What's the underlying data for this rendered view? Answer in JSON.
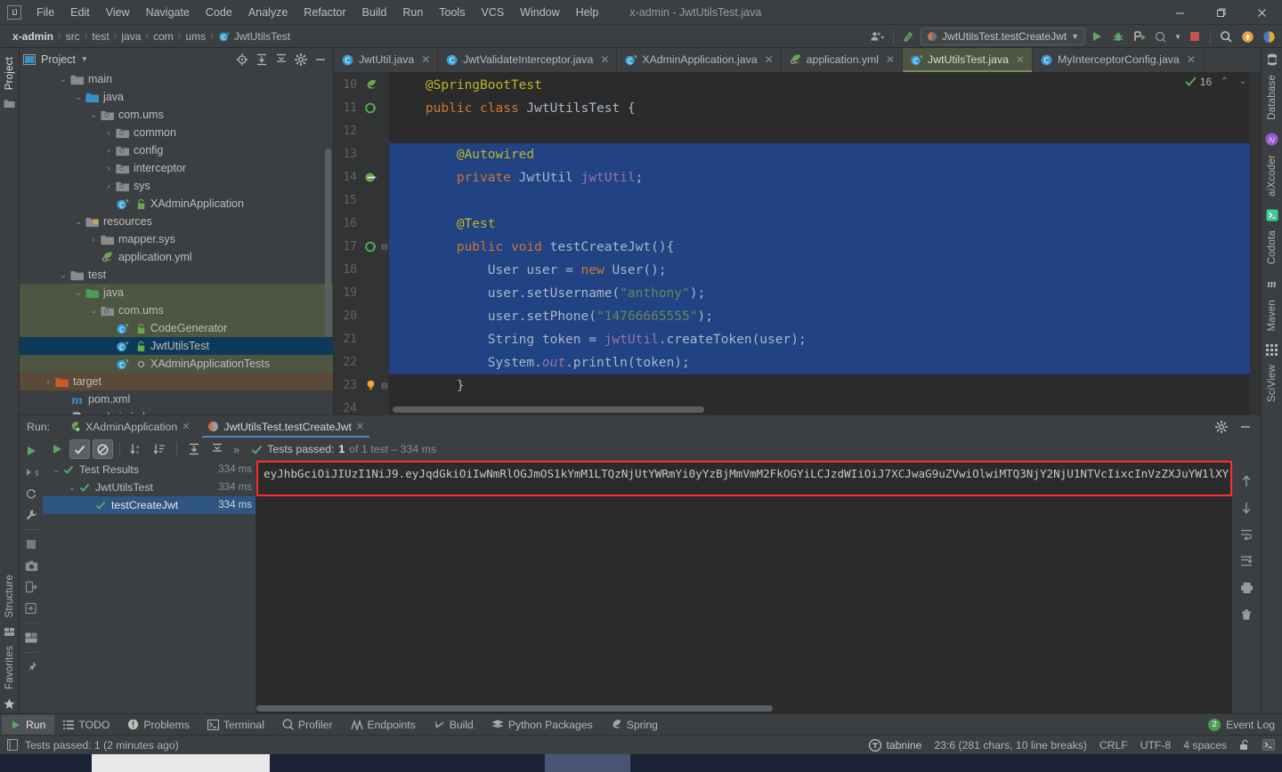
{
  "window": {
    "title": "x-admin - JwtUtilsTest.java",
    "logo": "IJ",
    "minimize": "—",
    "maximize": "❐",
    "close": "✕"
  },
  "menubar": {
    "items": [
      "File",
      "Edit",
      "View",
      "Navigate",
      "Code",
      "Analyze",
      "Refactor",
      "Build",
      "Run",
      "Tools",
      "VCS",
      "Window",
      "Help"
    ]
  },
  "breadcrumb": {
    "items": [
      "x-admin",
      "src",
      "test",
      "java",
      "com",
      "ums",
      "JwtUtilsTest"
    ],
    "separator": "›"
  },
  "toolbar": {
    "run_config": "JwtUtilsTest.testCreateJwt",
    "icons": [
      "user-dropdown-icon",
      "update-project-icon",
      "run-icon",
      "debug-icon",
      "run-with-coverage-icon",
      "profiler-icon",
      "stop-icon",
      "search-everywhere-icon",
      "notifications-icon",
      "ai-assistant-icon"
    ]
  },
  "left_strip": {
    "top": [
      "Project"
    ],
    "bottom": [
      "Structure",
      "Favorites"
    ]
  },
  "right_strip": {
    "items": [
      "Database",
      "aiXcoder",
      "Codota",
      "Maven",
      "SciView"
    ]
  },
  "project_panel": {
    "title": "Project",
    "header_icons": [
      "locate-icon",
      "expand-all-icon",
      "collapse-all-icon",
      "settings-gear-icon",
      "hide-icon"
    ],
    "tree": [
      {
        "label": "main",
        "indent": 2,
        "arrow": "⌄",
        "icon": "folder-gray",
        "state": "none"
      },
      {
        "label": "java",
        "indent": 3,
        "arrow": "⌄",
        "icon": "folder-blue",
        "state": "none"
      },
      {
        "label": "com.ums",
        "indent": 4,
        "arrow": "⌄",
        "icon": "package-icon",
        "state": "none"
      },
      {
        "label": "common",
        "indent": 5,
        "arrow": "›",
        "icon": "package-icon",
        "state": "none"
      },
      {
        "label": "config",
        "indent": 5,
        "arrow": "›",
        "icon": "package-icon",
        "state": "none"
      },
      {
        "label": "interceptor",
        "indent": 5,
        "arrow": "›",
        "icon": "package-icon",
        "state": "none"
      },
      {
        "label": "sys",
        "indent": 5,
        "arrow": "›",
        "icon": "package-icon",
        "state": "none"
      },
      {
        "label": "XAdminApplication",
        "indent": 5,
        "arrow": "",
        "icon": "spring-class",
        "state": "none"
      },
      {
        "label": "resources",
        "indent": 3,
        "arrow": "⌄",
        "icon": "folder-res",
        "state": "none"
      },
      {
        "label": "mapper.sys",
        "indent": 4,
        "arrow": "›",
        "icon": "folder-gray",
        "state": "none"
      },
      {
        "label": "application.yml",
        "indent": 4,
        "arrow": "",
        "icon": "spring-yml",
        "state": "none"
      },
      {
        "label": "test",
        "indent": 2,
        "arrow": "⌄",
        "icon": "folder-gray",
        "state": "none"
      },
      {
        "label": "java",
        "indent": 3,
        "arrow": "⌄",
        "icon": "folder-green",
        "state": "green"
      },
      {
        "label": "com.ums",
        "indent": 4,
        "arrow": "⌄",
        "icon": "package-icon",
        "state": "green"
      },
      {
        "label": "CodeGenerator",
        "indent": 5,
        "arrow": "",
        "icon": "test-class",
        "state": "green"
      },
      {
        "label": "JwtUtilsTest",
        "indent": 5,
        "arrow": "",
        "icon": "test-class",
        "state": "blue"
      },
      {
        "label": "XAdminApplicationTests",
        "indent": 5,
        "arrow": "",
        "icon": "test-class-o",
        "state": "green"
      },
      {
        "label": "target",
        "indent": 1,
        "arrow": "›",
        "icon": "folder-orange",
        "state": "brown"
      },
      {
        "label": "pom.xml",
        "indent": 2,
        "arrow": "",
        "icon": "maven-icon",
        "state": "none"
      },
      {
        "label": "x-admin.iml",
        "indent": 2,
        "arrow": "",
        "icon": "iml-icon",
        "state": "none"
      }
    ]
  },
  "editor": {
    "tabs": [
      {
        "label": "JwtUtil.java",
        "icon": "java-class-icon",
        "active": false
      },
      {
        "label": "JwtValidateInterceptor.java",
        "icon": "java-class-icon",
        "active": false
      },
      {
        "label": "XAdminApplication.java",
        "icon": "spring-class-icon",
        "active": false
      },
      {
        "label": "application.yml",
        "icon": "spring-yml-icon",
        "active": false
      },
      {
        "label": "JwtUtilsTest.java",
        "icon": "test-class-icon",
        "active": true
      },
      {
        "label": "MyInterceptorConfig.java",
        "icon": "java-class-icon",
        "active": false
      }
    ],
    "inspection_count": "16",
    "lines": [
      {
        "num": "10",
        "gutter": "spring-bean-icon",
        "selected": false,
        "tokens": [
          {
            "t": "    ",
            "c": "k-plain"
          },
          {
            "t": "@SpringBootTest",
            "c": "k-ann"
          }
        ]
      },
      {
        "num": "11",
        "gutter": "override-icon",
        "selected": false,
        "tokens": [
          {
            "t": "    ",
            "c": "k-plain"
          },
          {
            "t": "public",
            "c": "k-kw"
          },
          {
            "t": " ",
            "c": "k-plain"
          },
          {
            "t": "class",
            "c": "k-kw"
          },
          {
            "t": " JwtUtilsTest {",
            "c": "k-cls"
          }
        ]
      },
      {
        "num": "12",
        "gutter": "",
        "selected": false,
        "tokens": [
          {
            "t": "",
            "c": "k-plain"
          }
        ]
      },
      {
        "num": "13",
        "gutter": "",
        "selected": true,
        "tokens": [
          {
            "t": "        ",
            "c": "k-plain"
          },
          {
            "t": "@Autowired",
            "c": "k-ann"
          }
        ]
      },
      {
        "num": "14",
        "gutter": "bean-link-icon",
        "selected": true,
        "tokens": [
          {
            "t": "        ",
            "c": "k-plain"
          },
          {
            "t": "private",
            "c": "k-kw"
          },
          {
            "t": " JwtUtil ",
            "c": "k-cls"
          },
          {
            "t": "jwtUtil",
            "c": "k-field"
          },
          {
            "t": ";",
            "c": "k-cls"
          }
        ]
      },
      {
        "num": "15",
        "gutter": "",
        "selected": true,
        "tokens": [
          {
            "t": "",
            "c": "k-plain"
          }
        ]
      },
      {
        "num": "16",
        "gutter": "",
        "selected": true,
        "tokens": [
          {
            "t": "        ",
            "c": "k-plain"
          },
          {
            "t": "@Test",
            "c": "k-ann"
          }
        ]
      },
      {
        "num": "17",
        "gutter": "run-test-icon",
        "selected": true,
        "tokens": [
          {
            "t": "        ",
            "c": "k-plain"
          },
          {
            "t": "public",
            "c": "k-kw"
          },
          {
            "t": " ",
            "c": "k-plain"
          },
          {
            "t": "void",
            "c": "k-kw"
          },
          {
            "t": " testCreateJwt(){",
            "c": "k-cls"
          }
        ]
      },
      {
        "num": "18",
        "gutter": "",
        "selected": true,
        "tokens": [
          {
            "t": "            User user = ",
            "c": "k-cls"
          },
          {
            "t": "new",
            "c": "k-kw"
          },
          {
            "t": " User();",
            "c": "k-cls"
          }
        ]
      },
      {
        "num": "19",
        "gutter": "",
        "selected": true,
        "tokens": [
          {
            "t": "            user.setUsername(",
            "c": "k-cls"
          },
          {
            "t": "\"anthony\"",
            "c": "k-str"
          },
          {
            "t": ");",
            "c": "k-cls"
          }
        ]
      },
      {
        "num": "20",
        "gutter": "",
        "selected": true,
        "tokens": [
          {
            "t": "            user.setPhone(",
            "c": "k-cls"
          },
          {
            "t": "\"14766665555\"",
            "c": "k-str"
          },
          {
            "t": ");",
            "c": "k-cls"
          }
        ]
      },
      {
        "num": "21",
        "gutter": "",
        "selected": true,
        "tokens": [
          {
            "t": "            String token = ",
            "c": "k-cls"
          },
          {
            "t": "jwtUtil",
            "c": "k-field"
          },
          {
            "t": ".createToken(user);",
            "c": "k-cls"
          }
        ]
      },
      {
        "num": "22",
        "gutter": "",
        "selected": true,
        "tokens": [
          {
            "t": "            System.",
            "c": "k-cls"
          },
          {
            "t": "out",
            "c": "k-static"
          },
          {
            "t": ".println(token);",
            "c": "k-cls"
          }
        ]
      },
      {
        "num": "23",
        "gutter": "intention-bulb-icon",
        "selected": false,
        "tokens": [
          {
            "t": "        }",
            "c": "k-cls"
          }
        ]
      },
      {
        "num": "24",
        "gutter": "",
        "selected": false,
        "tokens": [
          {
            "t": "",
            "c": "k-plain"
          }
        ]
      }
    ]
  },
  "run_panel": {
    "label": "Run:",
    "tabs": [
      {
        "label": "XAdminApplication",
        "icon": "spring-run-icon",
        "active": false
      },
      {
        "label": "JwtUtilsTest.testCreateJwt",
        "icon": "test-run-icon",
        "active": true
      }
    ],
    "header_icons": [
      "settings-gear-icon",
      "hide-icon"
    ],
    "left_tools": [
      "rerun-icon",
      "rerun-failed-icon",
      "toggle-auto-test-icon",
      "test-settings-icon",
      "stop-icon",
      "screenshot-icon",
      "export-icon",
      "import-icon",
      "layout-icon",
      "pin-icon"
    ],
    "toolbar": {
      "icons": [
        "run-icon",
        "show-passed-icon",
        "hide-ignored-icon",
        "sort-alphabetically-icon",
        "sort-by-duration-icon",
        "expand-all-icon",
        "collapse-all-icon",
        "more-icon"
      ],
      "more": "»"
    },
    "status": {
      "prefix": "Tests passed:",
      "count": "1",
      "suffix": "of 1 test – 334 ms"
    },
    "tree": [
      {
        "label": "Test Results",
        "time": "334 ms",
        "indent": 0,
        "arrow": "⌄",
        "selected": false
      },
      {
        "label": "JwtUtilsTest",
        "time": "334 ms",
        "indent": 1,
        "arrow": "⌄",
        "selected": false
      },
      {
        "label": "testCreateJwt",
        "time": "334 ms",
        "indent": 2,
        "arrow": "",
        "selected": true
      }
    ],
    "console_output": "eyJhbGciOiJIUzI1NiJ9.eyJqdGkiOiIwNmRlOGJmOS1kYmM1LTQzNjUtYWRmYi0yYzBjMmVmM2FkOGYiLCJzdWIiOiJ7XCJwaG9uZVwiOlwiMTQ3NjY2NjU1NTVcIixcInVzZXJuYW1lXY",
    "right_icons": [
      "scroll-up-icon",
      "scroll-down-icon",
      "soft-wrap-icon",
      "scroll-to-end-icon",
      "print-icon",
      "clear-all-icon"
    ],
    "highlight_color": "#ff2d2d"
  },
  "toolwindow_bar": {
    "items": [
      {
        "label": "Run",
        "icon": "run-icon",
        "active": true
      },
      {
        "label": "TODO",
        "icon": "todo-icon",
        "active": false
      },
      {
        "label": "Problems",
        "icon": "problems-icon",
        "active": false
      },
      {
        "label": "Terminal",
        "icon": "terminal-icon",
        "active": false
      },
      {
        "label": "Profiler",
        "icon": "profiler-icon",
        "active": false
      },
      {
        "label": "Endpoints",
        "icon": "endpoints-icon",
        "active": false
      },
      {
        "label": "Build",
        "icon": "build-icon",
        "active": false
      },
      {
        "label": "Python Packages",
        "icon": "python-icon",
        "active": false
      },
      {
        "label": "Spring",
        "icon": "spring-icon",
        "active": false
      }
    ],
    "event_log": {
      "label": "Event Log",
      "badge": "2"
    }
  },
  "statusbar": {
    "message": "Tests passed: 1 (2 minutes ago)",
    "tabnine": "tabnine",
    "caret": "23:6 (281 chars, 10 line breaks)",
    "line_separator": "CRLF",
    "encoding": "UTF-8",
    "indent": "4 spaces",
    "icons": [
      "lock-icon",
      "terminal-small-icon"
    ]
  }
}
